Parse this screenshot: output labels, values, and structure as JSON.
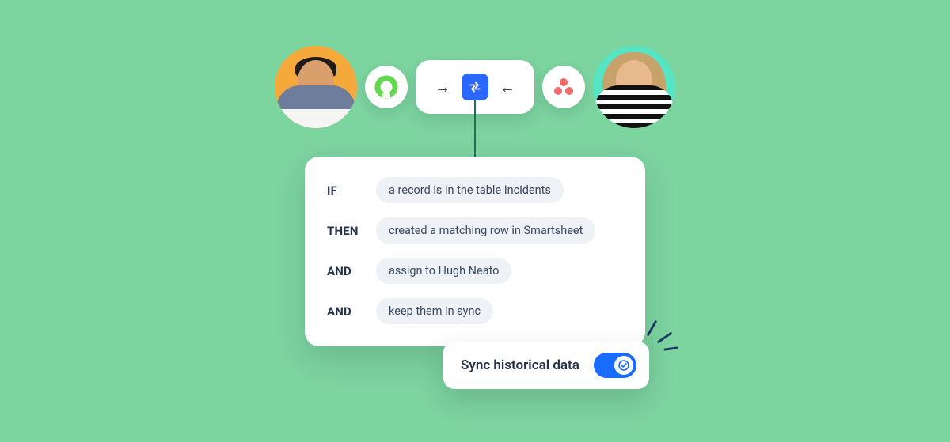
{
  "colors": {
    "page_bg": "#7cd49f",
    "card_bg": "#ffffff",
    "chip_bg": "#eef1f5",
    "text_primary": "#25324b",
    "text_chip": "#3a475f",
    "accent_blue": "#186cff",
    "sync_badge_blue": "#2a66ff",
    "avatar_left_bg": "#f5a93b",
    "avatar_right_bg": "#55e4c4",
    "servicenow_green": "#62d84e",
    "asana_pink": "#f06a6a"
  },
  "top": {
    "left_app_icon": "servicenow-icon",
    "right_app_icon": "asana-icon",
    "sync_badge_icon": "two-way-arrows-icon"
  },
  "rules": [
    {
      "keyword": "IF",
      "text": "a record is in the table Incidents"
    },
    {
      "keyword": "THEN",
      "text": "created a matching row in Smartsheet"
    },
    {
      "keyword": "AND",
      "text": "assign to Hugh Neato"
    },
    {
      "keyword": "AND",
      "text": "keep them in sync"
    }
  ],
  "history": {
    "label": "Sync historical data",
    "toggle_on": true
  }
}
